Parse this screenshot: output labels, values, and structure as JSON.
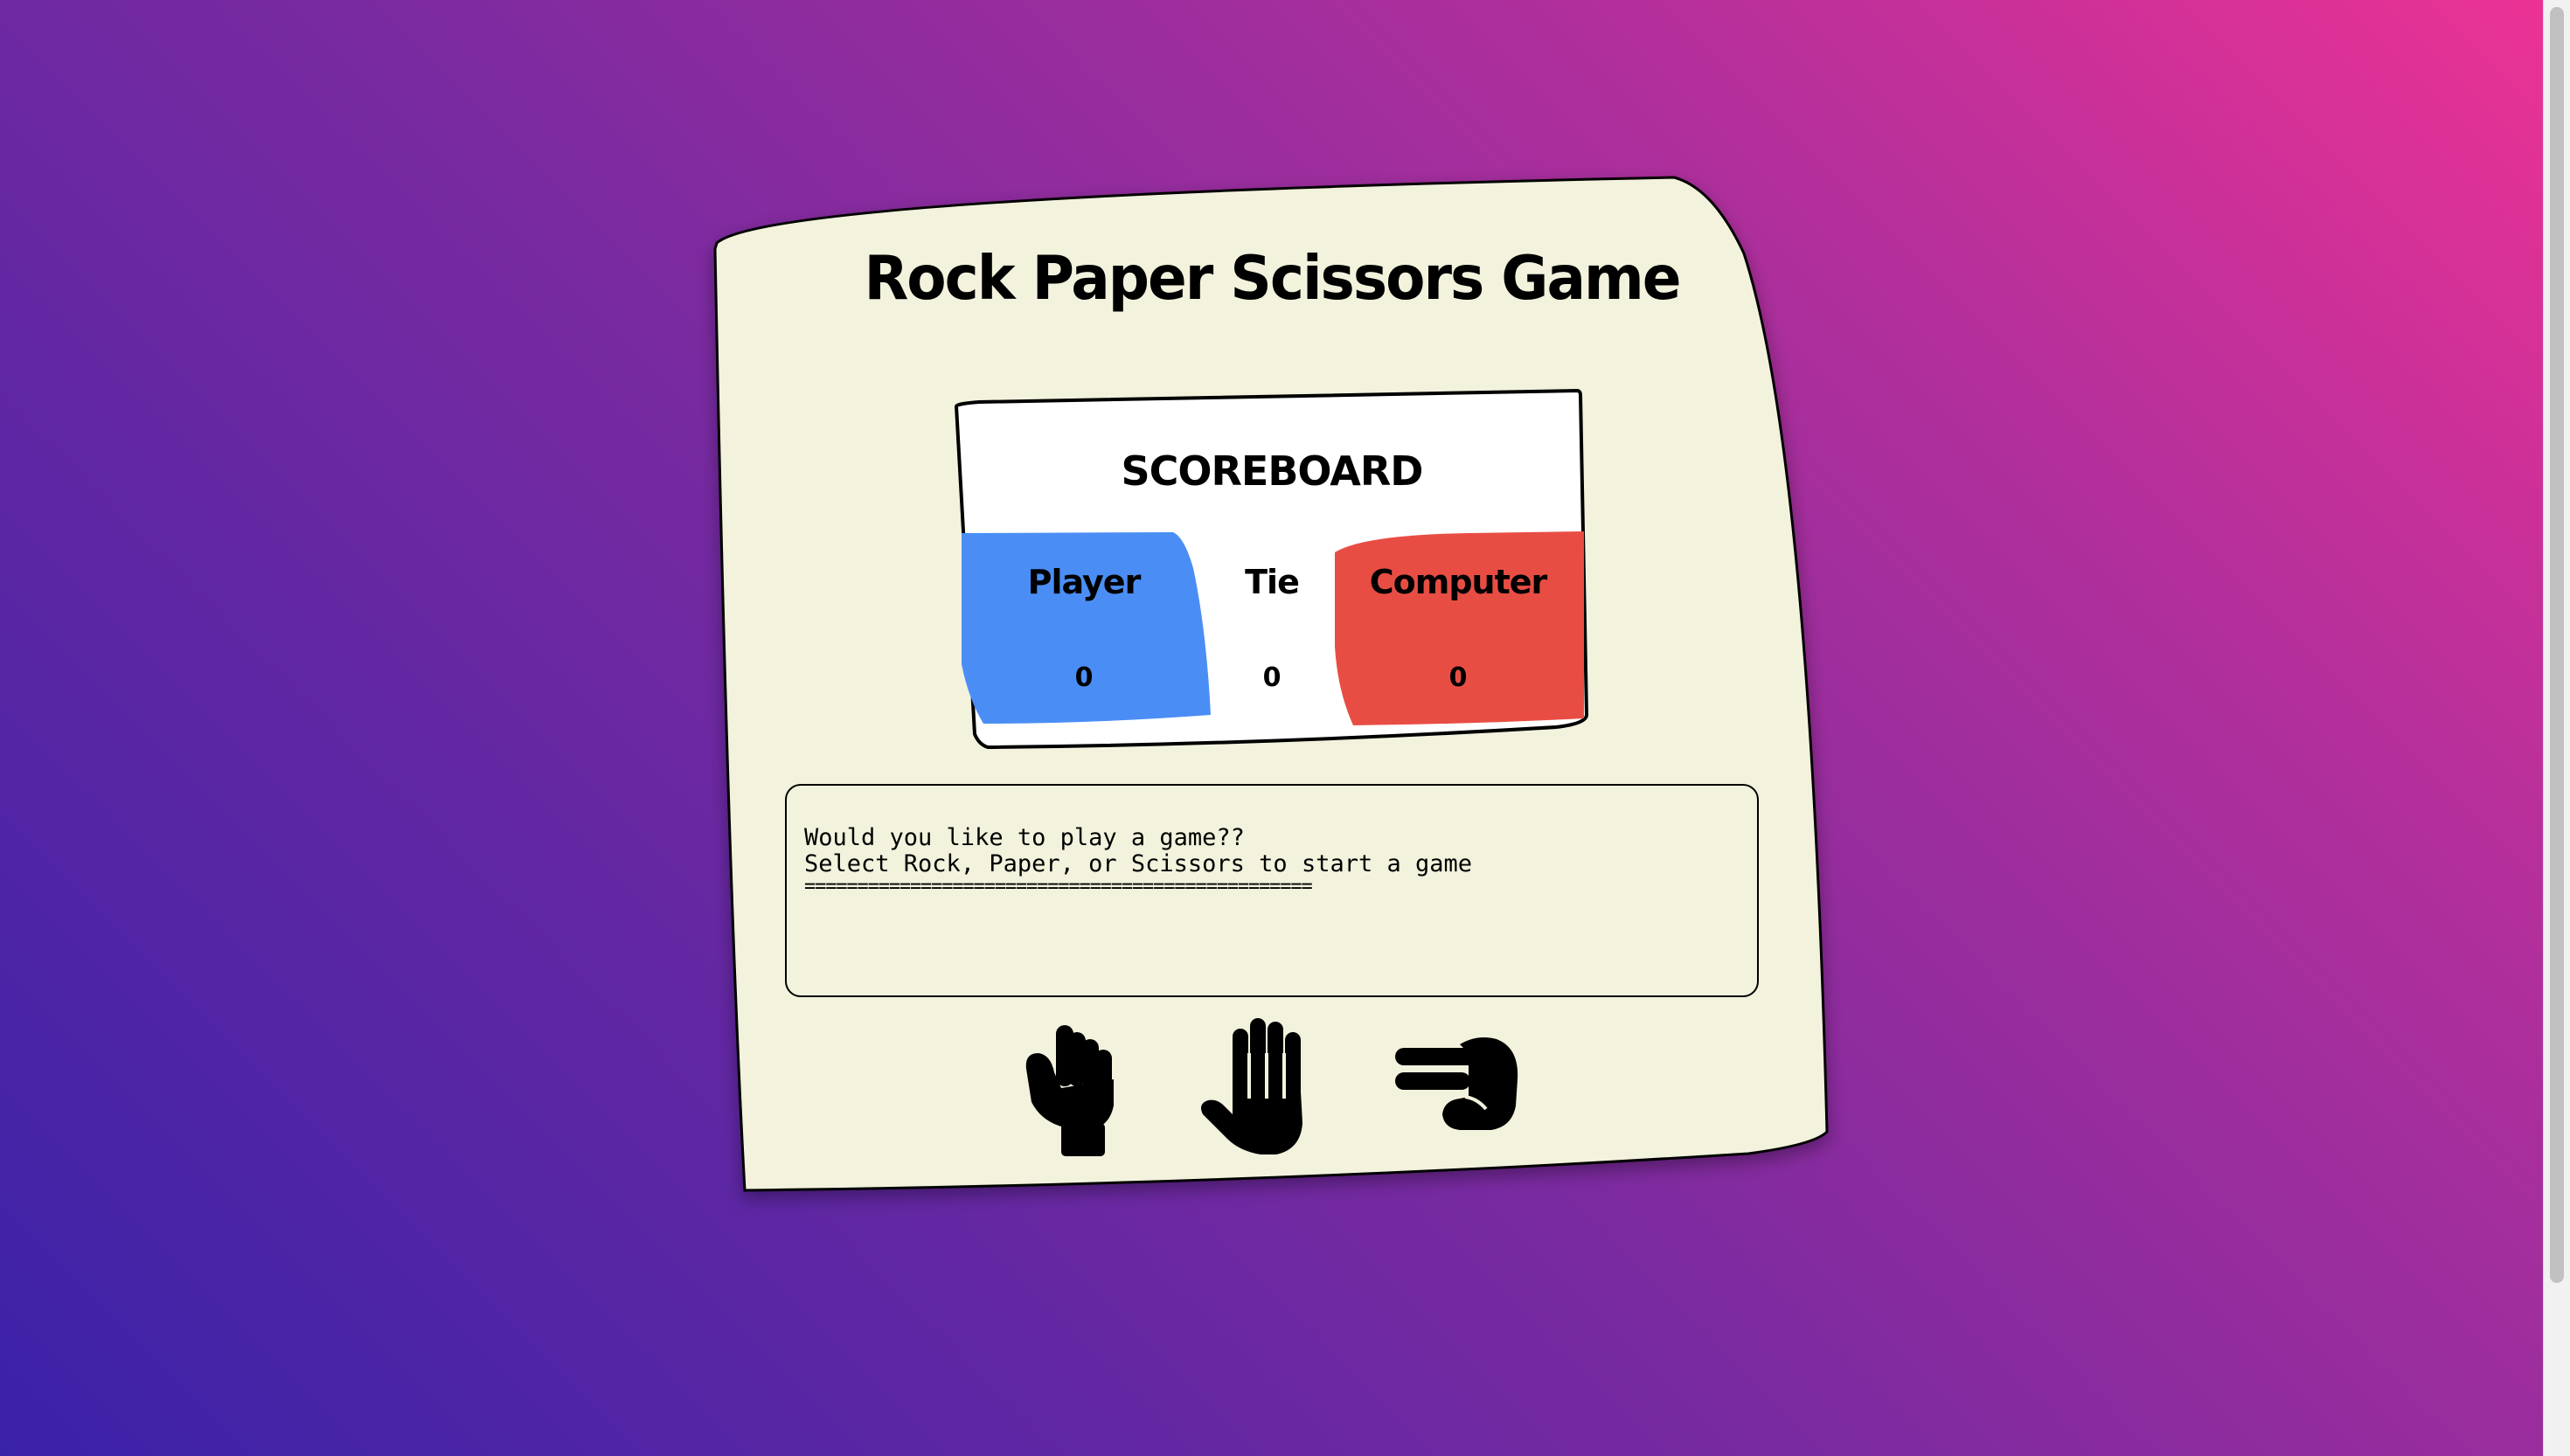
{
  "game": {
    "title": "Rock Paper Scissors Game"
  },
  "scoreboard": {
    "title": "SCOREBOARD",
    "player": {
      "label": "Player",
      "value": "0",
      "color": "#4a8ef5"
    },
    "tie": {
      "label": "Tie",
      "value": "0"
    },
    "computer": {
      "label": "Computer",
      "value": "0",
      "color": "#e84d44"
    }
  },
  "message": {
    "line1": "Would you like to play a game??",
    "line2": "Select Rock, Paper, or Scissors to start a game",
    "line3": "================================================"
  },
  "choices": [
    {
      "name": "Rock",
      "icon": "rock-hand-icon"
    },
    {
      "name": "Paper",
      "icon": "paper-hand-icon"
    },
    {
      "name": "Scissors",
      "icon": "scissors-hand-icon"
    }
  ],
  "colors": {
    "card": "#f2f2dd",
    "background_start": "#3a22a8",
    "background_end": "#ec3294"
  }
}
